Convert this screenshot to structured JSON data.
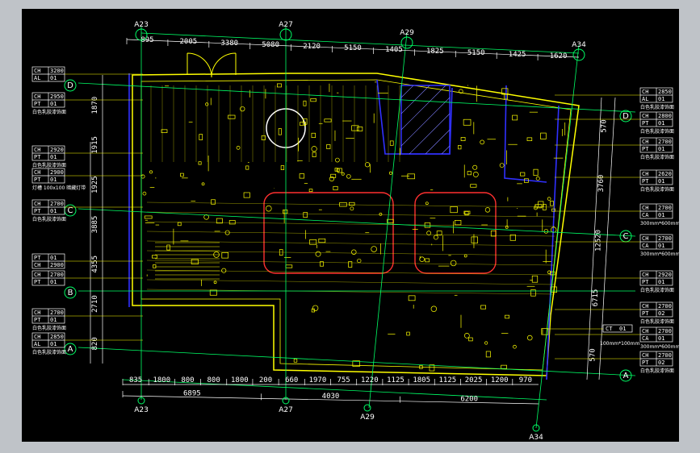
{
  "colors": {
    "background": "#000000",
    "walls": "#ffff00",
    "axes": "#00ff66",
    "partition": "#3030ff",
    "ceiling": "#ff3030",
    "text": "#ffffff",
    "window": "#bfc3c8"
  },
  "axis_bubbles": {
    "top": [
      "A23",
      "A27",
      "A29",
      "A34"
    ],
    "bottom": [
      "A23",
      "A27",
      "A29",
      "A34"
    ],
    "left": [
      "D",
      "C",
      "B",
      "A"
    ],
    "right": [
      "D",
      "C",
      "A"
    ]
  },
  "top_dims": [
    "895",
    "2005",
    "3380",
    "5080",
    "2120",
    "5150",
    "1405",
    "1825",
    "5150",
    "1425",
    "1620"
  ],
  "bottom_dims_row1": [
    "835",
    "1800",
    "800",
    "800",
    "1800",
    "200",
    "660",
    "1970",
    "755",
    "1220",
    "1125",
    "1805",
    "1125",
    "2025",
    "1200",
    "970"
  ],
  "bottom_dims_row2": [
    "6895",
    "4030",
    "6200"
  ],
  "left_dims_outer": [
    "1870",
    "1915",
    "1925",
    "3885",
    "4355",
    "2710",
    "820"
  ],
  "right_dims": [
    "570",
    "3760",
    "12520",
    "6715",
    "570"
  ],
  "left_tags": [
    {
      "r1k": "CH",
      "r1v": "3200",
      "r2k": "AL",
      "r2v": "01",
      "note": ""
    },
    {
      "r1k": "CH",
      "r1v": "2950",
      "r2k": "PT",
      "r2v": "01",
      "note": "白色乳胶漆饰面"
    },
    {
      "r1k": "CH",
      "r1v": "2920",
      "r2k": "PT",
      "r2v": "01",
      "note": "白色乳胶漆饰面"
    },
    {
      "r1k": "CH",
      "r1v": "2900",
      "r2k": "PT",
      "r2v": "01",
      "note": "灯槽 100x100 暗藏灯带"
    },
    {
      "r1k": "CH",
      "r1v": "2700",
      "r2k": "PT",
      "r2v": "01",
      "note": "白色乳胶漆饰面"
    },
    {
      "r1k": "PT",
      "r1v": "01",
      "r2k": "CH",
      "r2v": "2900",
      "note": ""
    },
    {
      "r1k": "CH",
      "r1v": "2700",
      "r2k": "PT",
      "r2v": "01",
      "note": ""
    },
    {
      "r1k": "CH",
      "r1v": "2700",
      "r2k": "PT",
      "r2v": "01",
      "note": "白色乳胶漆饰面"
    },
    {
      "r1k": "CH",
      "r1v": "2850",
      "r2k": "AL",
      "r2v": "01",
      "note": "白色乳胶漆饰面"
    }
  ],
  "right_tags": [
    {
      "r1k": "CH",
      "r1v": "2850",
      "r2k": "AL",
      "r2v": "01",
      "note": "白色乳胶漆饰面"
    },
    {
      "r1k": "CH",
      "r1v": "2800",
      "r2k": "PT",
      "r2v": "01",
      "note": "白色乳胶漆饰面"
    },
    {
      "r1k": "CH",
      "r1v": "2700",
      "r2k": "PT",
      "r2v": "01",
      "note": "白色乳胶漆饰面"
    },
    {
      "r1k": "CH",
      "r1v": "2620",
      "r2k": "PT",
      "r2v": "01",
      "note": "白色乳胶漆饰面"
    },
    {
      "r1k": "CH",
      "r1v": "2700",
      "r2k": "CA",
      "r2v": "01",
      "note": "300mm*600mm"
    },
    {
      "r1k": "CH",
      "r1v": "2700",
      "r2k": "CA",
      "r2v": "01",
      "note": "300mm*600mm"
    },
    {
      "r1k": "CH",
      "r1v": "2920",
      "r2k": "PT",
      "r2v": "01",
      "note": "白色乳胶漆饰面"
    },
    {
      "r1k": "CH",
      "r1v": "2700",
      "r2k": "PT",
      "r2v": "02",
      "note": "白色乳胶漆饰面"
    },
    {
      "r1k": "CH",
      "r1v": "2700",
      "r2k": "CA",
      "r2v": "01",
      "note": "300mm*600mm"
    },
    {
      "r1k": "CH",
      "r1v": "2700",
      "r2k": "PT",
      "r2v": "02",
      "note": "白色乳胶漆饰面"
    }
  ],
  "ct_tag": {
    "k": "CT",
    "v": "01",
    "note": "100mm*100mm"
  }
}
